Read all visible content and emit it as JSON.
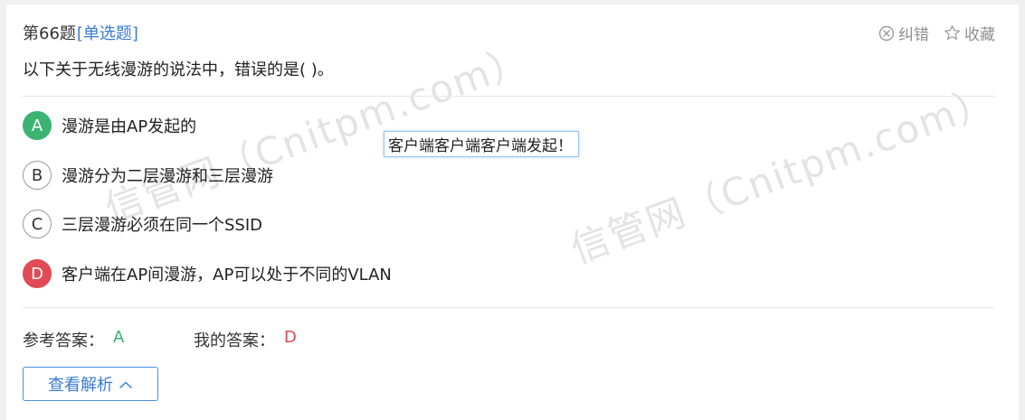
{
  "question": {
    "number_label": "第66题",
    "type_label": "[单选题]",
    "text": "以下关于无线漫游的说法中，错误的是( )。"
  },
  "actions": {
    "report_error": {
      "label": "纠错",
      "icon": "circle-x-icon"
    },
    "favorite": {
      "label": "收藏",
      "icon": "star-outline-icon"
    }
  },
  "options": [
    {
      "letter": "A",
      "text": "漫游是由AP发起的",
      "state": "correct"
    },
    {
      "letter": "B",
      "text": "漫游分为二层漫游和三层漫游",
      "state": "normal"
    },
    {
      "letter": "C",
      "text": "三层漫游必须在同一个SSID",
      "state": "normal"
    },
    {
      "letter": "D",
      "text": "客户端在AP间漫游，AP可以处于不同的VLAN",
      "state": "wrong"
    }
  ],
  "note": "客户端客户端客户端发起！",
  "answers": {
    "reference_label": "参考答案：",
    "reference_value": "A",
    "mine_label": "我的答案：",
    "mine_value": "D"
  },
  "analysis_button": {
    "label": "查看解析",
    "icon": "chevron-up-icon"
  },
  "watermark": [
    "信管网（Cnitpm.com）",
    "信管网（Cnitpm.com）"
  ],
  "colors": {
    "accent_blue": "#3a7bd5",
    "correct_green": "#3cb371",
    "wrong_red": "#e04b55",
    "muted_gray": "#8f8f8f"
  }
}
